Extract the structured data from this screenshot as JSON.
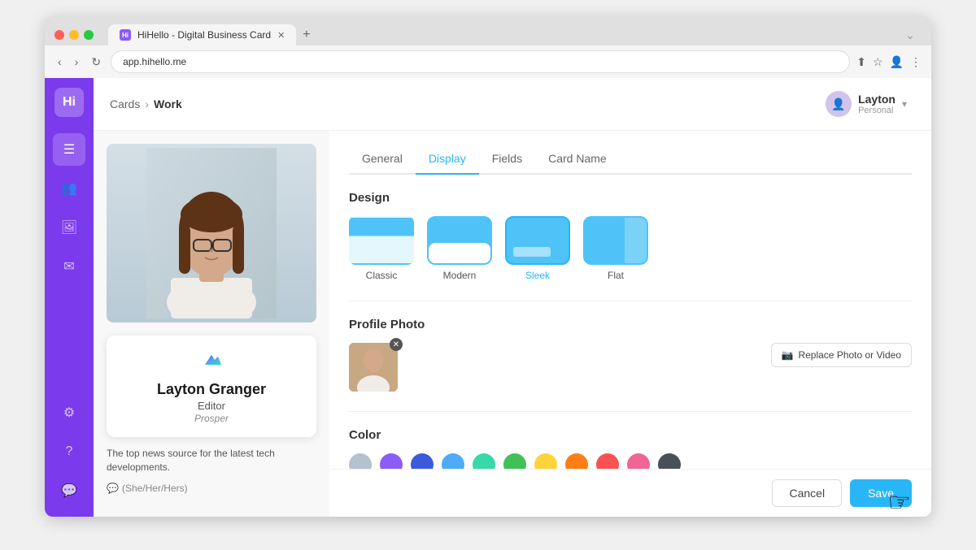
{
  "browser": {
    "tab_label": "HiHello - Digital Business Card",
    "address": "app.hihello.me",
    "favicon_text": "Hi"
  },
  "breadcrumb": {
    "parent": "Cards",
    "separator": "›",
    "current": "Work"
  },
  "user": {
    "name": "Layton",
    "role": "Personal",
    "avatar_text": "👤"
  },
  "tabs": [
    {
      "label": "General",
      "active": false
    },
    {
      "label": "Display",
      "active": true
    },
    {
      "label": "Fields",
      "active": false
    },
    {
      "label": "Card Name",
      "active": false
    }
  ],
  "design": {
    "section_title": "Design",
    "options": [
      {
        "label": "Classic",
        "style": "classic",
        "selected": false
      },
      {
        "label": "Modern",
        "style": "modern",
        "selected": false
      },
      {
        "label": "Sleek",
        "style": "sleek",
        "selected": true
      },
      {
        "label": "Flat",
        "style": "flat",
        "selected": false
      }
    ]
  },
  "profile_photo": {
    "section_title": "Profile Photo",
    "replace_label": "Replace Photo or Video"
  },
  "color": {
    "section_title": "Color",
    "swatches": [
      "#b5c0d0",
      "#8b5cf6",
      "#3b5bdb",
      "#4dabf7",
      "#38d9a9",
      "#40c057",
      "#ffd43b",
      "#fd7e14",
      "#fa5252",
      "#f06595",
      "#495057"
    ]
  },
  "card_preview": {
    "name": "Layton Granger",
    "title": "Editor",
    "company": "Prosper",
    "bio": "The top news source for the latest tech developments.",
    "pronouns": "(She/Her/Hers)"
  },
  "footer": {
    "cancel_label": "Cancel",
    "save_label": "Save"
  },
  "sidebar": {
    "logo_text": "Hi",
    "items": [
      {
        "icon": "📋",
        "name": "cards",
        "active": true
      },
      {
        "icon": "👥",
        "name": "contacts",
        "active": false
      },
      {
        "icon": "🖼",
        "name": "media",
        "active": false
      },
      {
        "icon": "✉",
        "name": "messages",
        "active": false
      },
      {
        "icon": "⚙",
        "name": "settings",
        "active": false
      },
      {
        "icon": "?",
        "name": "help",
        "active": false
      },
      {
        "icon": "💬",
        "name": "chat",
        "active": false
      }
    ]
  }
}
